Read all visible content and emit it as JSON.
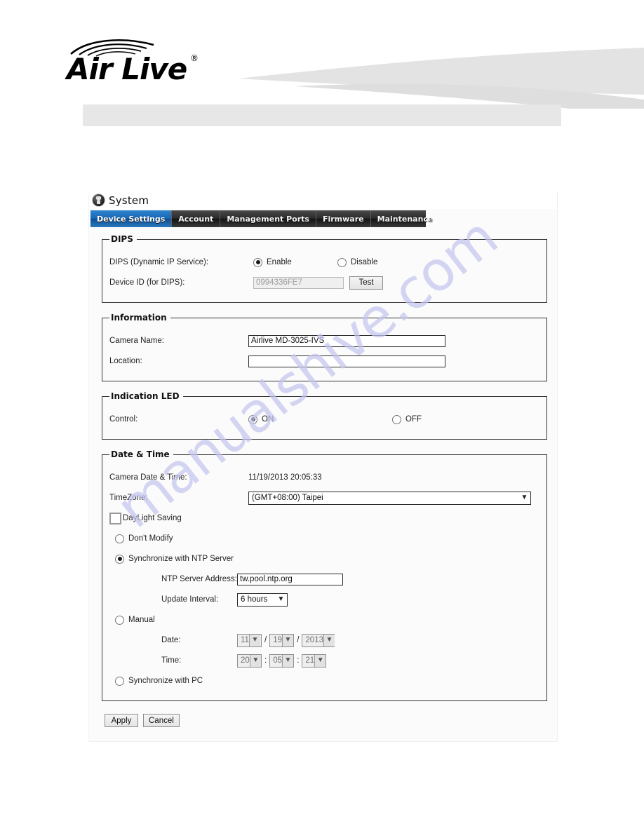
{
  "brand": {
    "logo_text": "Air Live",
    "logo_trademark": "®"
  },
  "watermark": {
    "text": "manualshive.com"
  },
  "panel": {
    "title": "System",
    "title_icon": "user-bust-icon",
    "tabs": [
      {
        "label": "Device Settings",
        "active": true
      },
      {
        "label": "Account",
        "active": false
      },
      {
        "label": "Management Ports",
        "active": false
      },
      {
        "label": "Firmware",
        "active": false
      },
      {
        "label": "Maintenance",
        "active": false
      }
    ]
  },
  "dips": {
    "legend": "DIPS",
    "service_label": "DIPS (Dynamic IP Service):",
    "enable_label": "Enable",
    "disable_label": "Disable",
    "selected": "Enable",
    "device_id_label": "Device ID (for DIPS):",
    "device_id_value": "0994336FE7",
    "test_button": "Test"
  },
  "information": {
    "legend": "Information",
    "camera_name_label": "Camera Name:",
    "camera_name_value": "Airlive MD-3025-IVS",
    "location_label": "Location:",
    "location_value": ""
  },
  "indication_led": {
    "legend": "Indication LED",
    "control_label": "Control:",
    "on_label": "ON",
    "off_label": "OFF",
    "selected": "ON"
  },
  "date_time": {
    "legend": "Date & Time",
    "camera_datetime_label": "Camera Date & Time:",
    "camera_datetime_value": "11/19/2013 20:05:33",
    "timezone_label": "TimeZone:",
    "timezone_value": "(GMT+08:00) Taipei",
    "daylight_saving_label": "DayLight Saving",
    "daylight_saving_checked": false,
    "mode_selected": "Synchronize with NTP Server",
    "dont_modify_label": "Don't Modify",
    "ntp_mode_label": "Synchronize with NTP Server",
    "ntp_server_label": "NTP Server Address:",
    "ntp_server_value": "tw.pool.ntp.org",
    "update_interval_label": "Update Interval:",
    "update_interval_value": "6 hours",
    "manual_label": "Manual",
    "date_label": "Date:",
    "date_month": "11",
    "date_day": "19",
    "date_year": "2013",
    "time_label": "Time:",
    "time_hour": "20",
    "time_minute": "05",
    "time_second": "21",
    "date_sep": "/",
    "time_sep": ":",
    "sync_pc_label": "Synchronize with PC"
  },
  "actions": {
    "apply_label": "Apply",
    "cancel_label": "Cancel"
  },
  "colors": {
    "active_tab": "#1a6ab8",
    "tab_bar": "#2d2d2d",
    "header_bar": "#e7e7e7",
    "watermark": "#c5c6ef"
  }
}
